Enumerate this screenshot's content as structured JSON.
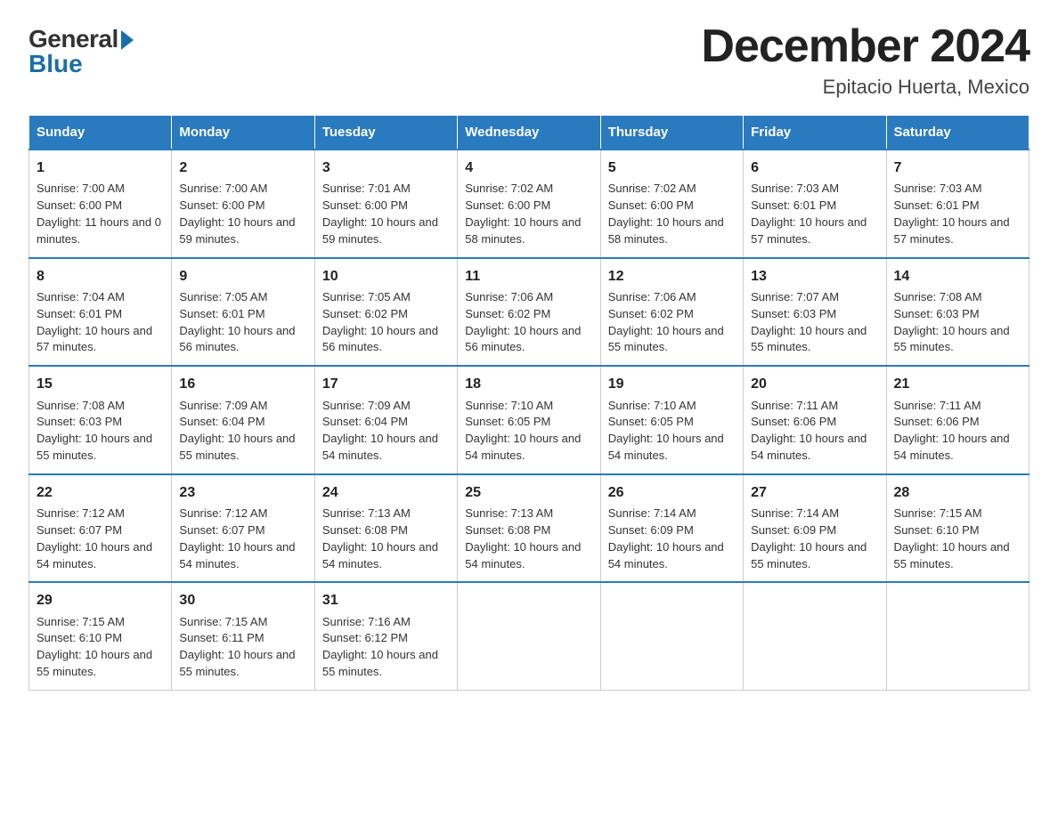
{
  "logo": {
    "general": "General",
    "blue": "Blue"
  },
  "header": {
    "month_year": "December 2024",
    "location": "Epitacio Huerta, Mexico"
  },
  "days_of_week": [
    "Sunday",
    "Monday",
    "Tuesday",
    "Wednesday",
    "Thursday",
    "Friday",
    "Saturday"
  ],
  "weeks": [
    [
      {
        "day": "1",
        "sunrise": "7:00 AM",
        "sunset": "6:00 PM",
        "daylight": "11 hours and 0 minutes."
      },
      {
        "day": "2",
        "sunrise": "7:00 AM",
        "sunset": "6:00 PM",
        "daylight": "10 hours and 59 minutes."
      },
      {
        "day": "3",
        "sunrise": "7:01 AM",
        "sunset": "6:00 PM",
        "daylight": "10 hours and 59 minutes."
      },
      {
        "day": "4",
        "sunrise": "7:02 AM",
        "sunset": "6:00 PM",
        "daylight": "10 hours and 58 minutes."
      },
      {
        "day": "5",
        "sunrise": "7:02 AM",
        "sunset": "6:00 PM",
        "daylight": "10 hours and 58 minutes."
      },
      {
        "day": "6",
        "sunrise": "7:03 AM",
        "sunset": "6:01 PM",
        "daylight": "10 hours and 57 minutes."
      },
      {
        "day": "7",
        "sunrise": "7:03 AM",
        "sunset": "6:01 PM",
        "daylight": "10 hours and 57 minutes."
      }
    ],
    [
      {
        "day": "8",
        "sunrise": "7:04 AM",
        "sunset": "6:01 PM",
        "daylight": "10 hours and 57 minutes."
      },
      {
        "day": "9",
        "sunrise": "7:05 AM",
        "sunset": "6:01 PM",
        "daylight": "10 hours and 56 minutes."
      },
      {
        "day": "10",
        "sunrise": "7:05 AM",
        "sunset": "6:02 PM",
        "daylight": "10 hours and 56 minutes."
      },
      {
        "day": "11",
        "sunrise": "7:06 AM",
        "sunset": "6:02 PM",
        "daylight": "10 hours and 56 minutes."
      },
      {
        "day": "12",
        "sunrise": "7:06 AM",
        "sunset": "6:02 PM",
        "daylight": "10 hours and 55 minutes."
      },
      {
        "day": "13",
        "sunrise": "7:07 AM",
        "sunset": "6:03 PM",
        "daylight": "10 hours and 55 minutes."
      },
      {
        "day": "14",
        "sunrise": "7:08 AM",
        "sunset": "6:03 PM",
        "daylight": "10 hours and 55 minutes."
      }
    ],
    [
      {
        "day": "15",
        "sunrise": "7:08 AM",
        "sunset": "6:03 PM",
        "daylight": "10 hours and 55 minutes."
      },
      {
        "day": "16",
        "sunrise": "7:09 AM",
        "sunset": "6:04 PM",
        "daylight": "10 hours and 55 minutes."
      },
      {
        "day": "17",
        "sunrise": "7:09 AM",
        "sunset": "6:04 PM",
        "daylight": "10 hours and 54 minutes."
      },
      {
        "day": "18",
        "sunrise": "7:10 AM",
        "sunset": "6:05 PM",
        "daylight": "10 hours and 54 minutes."
      },
      {
        "day": "19",
        "sunrise": "7:10 AM",
        "sunset": "6:05 PM",
        "daylight": "10 hours and 54 minutes."
      },
      {
        "day": "20",
        "sunrise": "7:11 AM",
        "sunset": "6:06 PM",
        "daylight": "10 hours and 54 minutes."
      },
      {
        "day": "21",
        "sunrise": "7:11 AM",
        "sunset": "6:06 PM",
        "daylight": "10 hours and 54 minutes."
      }
    ],
    [
      {
        "day": "22",
        "sunrise": "7:12 AM",
        "sunset": "6:07 PM",
        "daylight": "10 hours and 54 minutes."
      },
      {
        "day": "23",
        "sunrise": "7:12 AM",
        "sunset": "6:07 PM",
        "daylight": "10 hours and 54 minutes."
      },
      {
        "day": "24",
        "sunrise": "7:13 AM",
        "sunset": "6:08 PM",
        "daylight": "10 hours and 54 minutes."
      },
      {
        "day": "25",
        "sunrise": "7:13 AM",
        "sunset": "6:08 PM",
        "daylight": "10 hours and 54 minutes."
      },
      {
        "day": "26",
        "sunrise": "7:14 AM",
        "sunset": "6:09 PM",
        "daylight": "10 hours and 54 minutes."
      },
      {
        "day": "27",
        "sunrise": "7:14 AM",
        "sunset": "6:09 PM",
        "daylight": "10 hours and 55 minutes."
      },
      {
        "day": "28",
        "sunrise": "7:15 AM",
        "sunset": "6:10 PM",
        "daylight": "10 hours and 55 minutes."
      }
    ],
    [
      {
        "day": "29",
        "sunrise": "7:15 AM",
        "sunset": "6:10 PM",
        "daylight": "10 hours and 55 minutes."
      },
      {
        "day": "30",
        "sunrise": "7:15 AM",
        "sunset": "6:11 PM",
        "daylight": "10 hours and 55 minutes."
      },
      {
        "day": "31",
        "sunrise": "7:16 AM",
        "sunset": "6:12 PM",
        "daylight": "10 hours and 55 minutes."
      },
      null,
      null,
      null,
      null
    ]
  ]
}
